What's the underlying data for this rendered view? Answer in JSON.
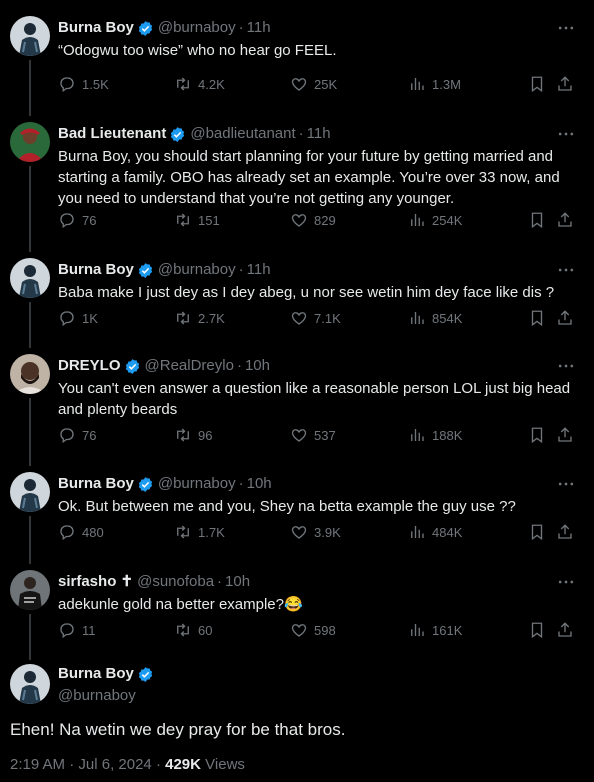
{
  "colors": {
    "background": "#000000",
    "text": "#e7e9ea",
    "muted": "#71767b",
    "verified": "#1d9bf0"
  },
  "tweets": [
    {
      "name": "Burna Boy",
      "verified": true,
      "handle": "@burnaboy",
      "time": "11h",
      "text": "“Odogwu too wise”  who no hear go FEEL.",
      "replies": "1.5K",
      "retweets": "4.2K",
      "likes": "25K",
      "views": "1.3M",
      "avatar": "burna"
    },
    {
      "name": "Bad Lieutenant",
      "verified": true,
      "handle": "@badlieutanant",
      "time": "11h",
      "text": "Burna Boy, you should start planning for your future by getting married and starting a family. OBO has already set an example. You’re over 33 now, and you need to understand that you’re not getting any younger.",
      "replies": "76",
      "retweets": "151",
      "likes": "829",
      "views": "254K",
      "avatar": "bad"
    },
    {
      "name": "Burna Boy",
      "verified": true,
      "handle": "@burnaboy",
      "time": "11h",
      "text": "Baba make I just dey as I dey abeg, u nor see wetin him dey face like dis ?",
      "replies": "1K",
      "retweets": "2.7K",
      "likes": "7.1K",
      "views": "854K",
      "avatar": "burna"
    },
    {
      "name": "DREYLO",
      "verified": true,
      "handle": "@RealDreylo",
      "time": "10h",
      "text": "You can't even answer a question like a reasonable person LOL just big head and plenty beards",
      "replies": "76",
      "retweets": "96",
      "likes": "537",
      "views": "188K",
      "avatar": "dreylo"
    },
    {
      "name": "Burna Boy",
      "verified": true,
      "handle": "@burnaboy",
      "time": "10h",
      "text": "Ok. But between me and you, Shey na betta example the guy use ??",
      "replies": "480",
      "retweets": "1.7K",
      "likes": "3.9K",
      "views": "484K",
      "avatar": "burna"
    },
    {
      "name": "sirfasho ✝",
      "verified": false,
      "handle": "@sunofoba",
      "time": "10h",
      "text": "adekunle gold na better example?😂",
      "replies": "11",
      "retweets": "60",
      "likes": "598",
      "views": "161K",
      "avatar": "sirfasho"
    }
  ],
  "focus": {
    "name": "Burna Boy",
    "verified": true,
    "handle": "@burnaboy",
    "text": "Ehen! Na wetin we dey pray for be that bros.",
    "time": "2:19 AM",
    "date": "Jul 6, 2024",
    "views_count": "429K",
    "views_label": "Views"
  }
}
